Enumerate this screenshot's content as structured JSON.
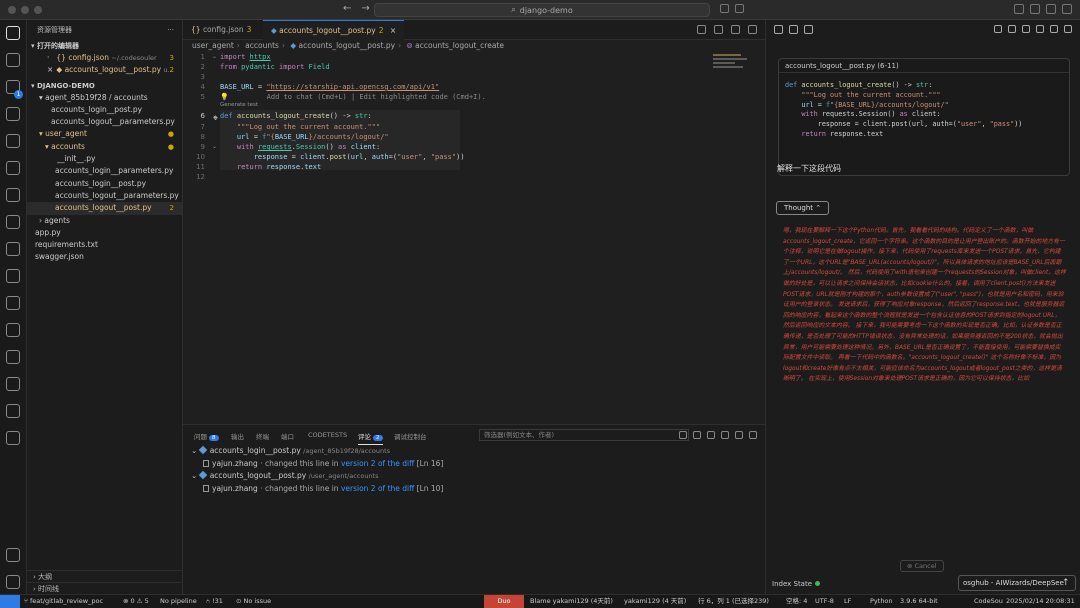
{
  "window": {
    "search_text": "django-demo"
  },
  "sidebar": {
    "title": "资源管理器",
    "open_editors_label": "打开的编辑器",
    "open_editors": [
      {
        "name": "config.json",
        "hint": "~/.codesouler",
        "badge": "3"
      },
      {
        "name": "accounts_logout__post.py",
        "hint": "u...",
        "badge": "2"
      }
    ],
    "project_label": "DJANGO-DEMO",
    "tree": [
      {
        "name": "agent_85b19f28 / accounts",
        "badge": ""
      },
      {
        "name": "accounts_login__post.py",
        "badge": ""
      },
      {
        "name": "accounts_logout__parameters.py",
        "badge": ""
      },
      {
        "name": "user_agent",
        "badge": ""
      },
      {
        "name": "accounts",
        "badge": ""
      },
      {
        "name": "__init__.py",
        "badge": ""
      },
      {
        "name": "accounts_login__parameters.py",
        "badge": ""
      },
      {
        "name": "accounts_login__post.py",
        "badge": ""
      },
      {
        "name": "accounts_logout__parameters.py",
        "badge": ""
      },
      {
        "name": "accounts_logout__post.py",
        "badge": "2"
      },
      {
        "name": "agents",
        "badge": ""
      },
      {
        "name": "app.py",
        "badge": ""
      },
      {
        "name": "requirements.txt",
        "badge": ""
      },
      {
        "name": "swagger.json",
        "badge": ""
      }
    ],
    "outline_label": "大纲",
    "timeline_label": "时间线"
  },
  "tabs": [
    {
      "label": "config.json",
      "num": "3"
    },
    {
      "label": "accounts_logout__post.py",
      "num": "2"
    }
  ],
  "breadcrumb": [
    "user_agent",
    "accounts",
    "accounts_logout__post.py",
    "accounts_logout_create"
  ],
  "editor": {
    "line_numbers": [
      "1",
      "2",
      "3",
      "4",
      "5",
      "6",
      "7",
      "8",
      "9",
      "10",
      "11",
      "12"
    ],
    "codelens": "Generate test",
    "ghost_hint": "Add to chat (Cmd+L) | Edit highlighted code (Cmd+I)."
  },
  "panel": {
    "tabs": [
      {
        "label": "问题",
        "badge": "8"
      },
      {
        "label": "输出",
        "badge": ""
      },
      {
        "label": "终端",
        "badge": ""
      },
      {
        "label": "端口",
        "badge": ""
      },
      {
        "label": "CODETESTS",
        "badge": ""
      },
      {
        "label": "评论",
        "badge": "2"
      },
      {
        "label": "调试控制台",
        "badge": ""
      }
    ],
    "filter_placeholder": "筛选器(例如文本、作者)",
    "comments": [
      {
        "file": "accounts_login__post.py",
        "path": "/agent_85b19f28/accounts",
        "user": "yajun.zhang",
        "action": "changed this line in",
        "link": "version 2 of the diff",
        "line": "[Ln 16]"
      },
      {
        "file": "accounts_logout__post.py",
        "path": "/user_agent/accounts",
        "user": "yajun.zhang",
        "action": "changed this line in",
        "link": "version 2 of the diff",
        "line": "[Ln 10]"
      }
    ]
  },
  "chat": {
    "code_card_title": "accounts_logout__post.py (6-11)",
    "prompt": "解释一下这段代码",
    "thought_label": "Thought",
    "thought_text": "嗯，我现在要解释一下这个Python代码。首先，我看看代码的结构。代码定义了一个函数，叫做accounts_logout_create，它返回一个字符串。这个函数的目的是让用户登出账户的。函数开始的地方有一个注释，说明它是在做logout操作。接下来，代码使用了requests库来发送一个POST请求。首先，它构建了一个URL，这个URL是\"BASE_URL(accounts/logout/)\"。所以具体请求的地址应该是BASE_URL后面跟上/accounts/logout/。 然后，代码使用了with语句来创建一个requests的Session对象，叫做client。这样做的好处是，可以让请求之间保持会话状态，比如cookie什么的。接着，调用了client.post()方法来发送POST请求。URL就是刚才构建的那个，auth参数设置成了(\"user\", \"pass\")，也就是用户名和密码，用来验证用户的登录状态。 发送请求后，获得了响应对象response，然后返回了response.text，也就是服务器返回的响应内容，看起来这个函数的整个流程就是发送一个包含认证信息的POST请求到指定的logout URL，然后返回响应的文本内容。 接下来，我可能需要考虑一下这个函数的实现是否正确。比如，认证参数是否正确传递，是否处理了可能的HTTP错误状态，没有异常处理的话，如果服务器返回的不是200状态，就会抛出异常，用户可能需要处理这种情况。另外，BASE_URL是否正确设置了，不能直接使用，可能需要替换成实际配置文件中读取。 再看一下代码中的函数名。\"accounts_logout_create()\" 这个名称好像不标准，因为logout和create好像有点不太相关，可能应该命名为accounts_logout或者logout_post之类的，这样更清晰明了。 在实现上，使用Session对象来处理POST请求是正确的，因为它可以保持状态，比如",
    "cancel_label": "Cancel",
    "index_state_label": "Index State",
    "model_label": "osghub - AIWizards/DeepSee"
  },
  "statusbar": {
    "branch": "feat/gitlab_review_poc",
    "errors": "0",
    "warnings": "5",
    "pipeline": "No pipeline",
    "mr": "!31",
    "issue": "No issue",
    "duo": "Duo",
    "blame": "Blame yakami129 (4天前)",
    "author": "yakami129 (4 天前)",
    "position": "行 6，列 1 (已选择239)",
    "spaces": "空格: 4",
    "encoding": "UTF-8",
    "eol": "LF",
    "lang": "Python",
    "pyver": "3.9.6 64-bit",
    "ext": "CodeSou",
    "datetime": "2025/02/14 20:08:31"
  }
}
